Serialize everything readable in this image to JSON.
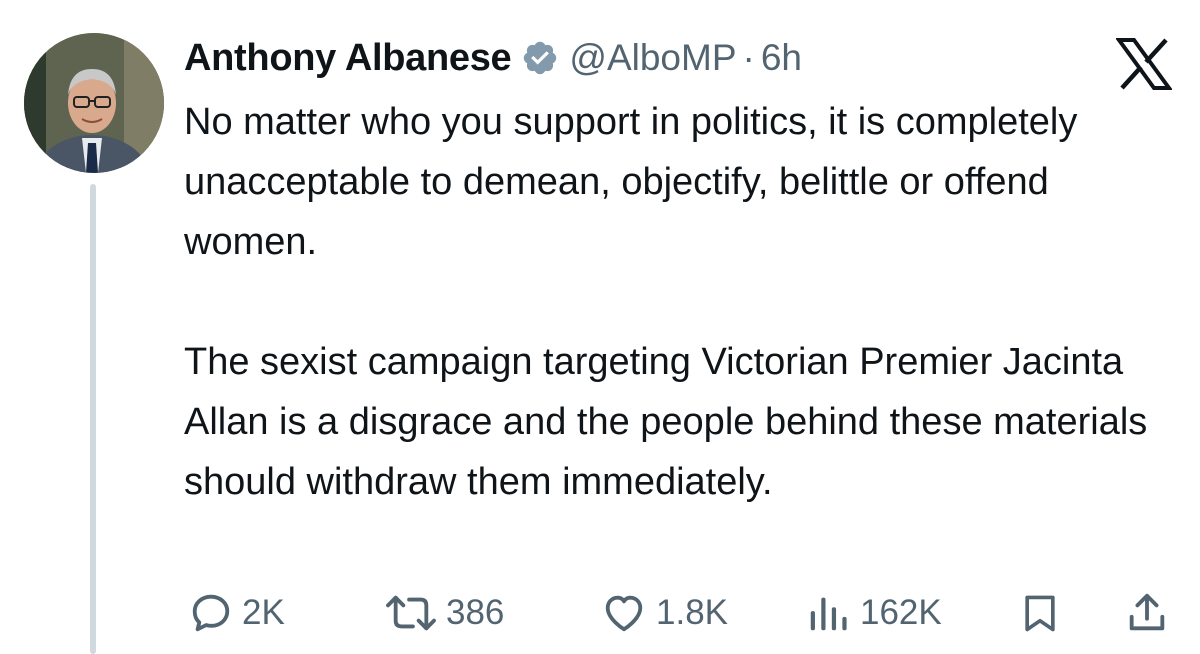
{
  "author": {
    "name": "Anthony Albanese",
    "handle": "@AlboMP",
    "separator": "·",
    "time": "6h"
  },
  "tweet": {
    "paragraphs": [
      "No matter who you support in politics, it is completely unacceptable to demean, objectify, belittle or offend women.",
      "The sexist campaign targeting Victorian Premier Jacinta Allan is a disgrace and the people behind these materials should withdraw them immediately."
    ]
  },
  "actions": {
    "replies": "2K",
    "reposts": "386",
    "likes": "1.8K",
    "views": "162K"
  },
  "colors": {
    "text": "#0f1419",
    "muted": "#536471",
    "verified": "#829aab",
    "thread_line": "#cfd9de"
  },
  "icons": {
    "verified": "verified-badge-icon",
    "close": "x-logo-icon",
    "reply": "reply-icon",
    "repost": "repost-icon",
    "like": "heart-icon",
    "views": "views-icon",
    "bookmark": "bookmark-icon",
    "share": "share-icon"
  }
}
